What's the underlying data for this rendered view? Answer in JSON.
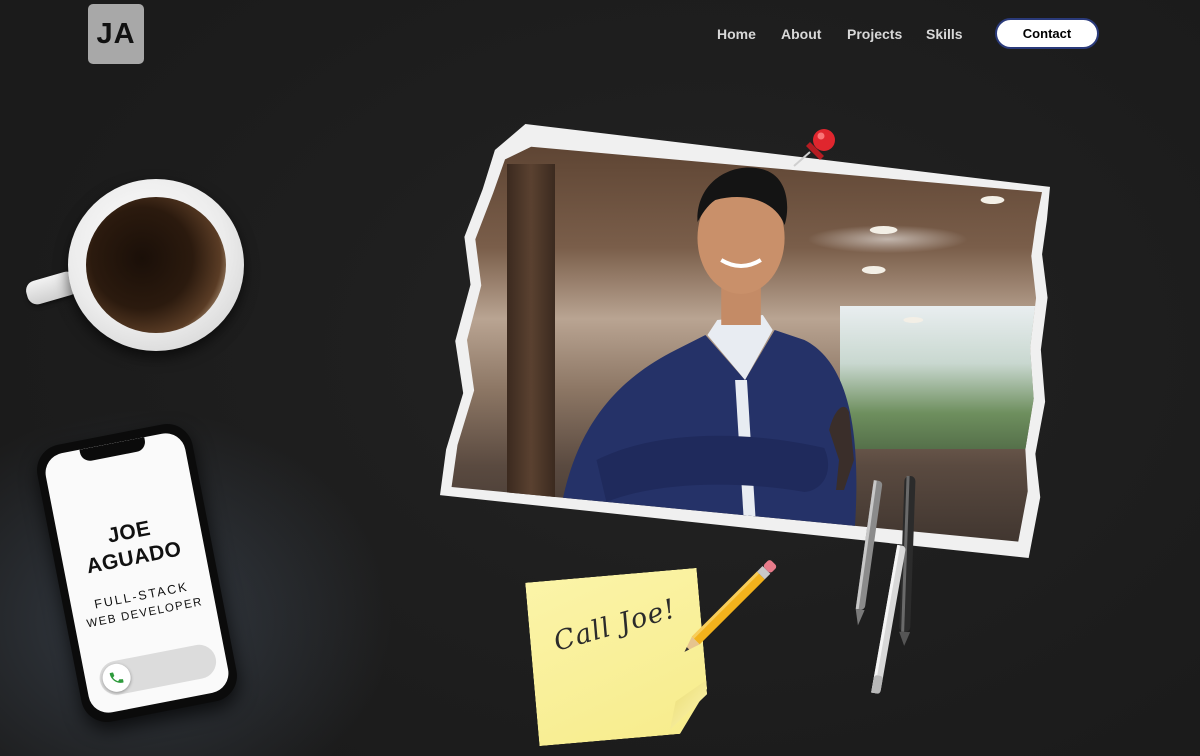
{
  "header": {
    "logo_text": "JA",
    "nav": [
      {
        "label": "Home"
      },
      {
        "label": "About"
      },
      {
        "label": "Projects"
      },
      {
        "label": "Skills"
      }
    ],
    "contact_label": "Contact"
  },
  "phone": {
    "name_line1": "JOE",
    "name_line2": "AGUADO",
    "role_line1": "FULL-STACK",
    "role_line2": "WEB DEVELOPER",
    "call_icon": "phone-icon"
  },
  "sticky_note": {
    "text": "Call Joe!"
  },
  "colors": {
    "background": "#1e1e1e",
    "logo_bg": "#a8a8a8",
    "contact_border": "#2a3a7a",
    "sticky": "#f7ec8c",
    "pin": "#d9232b",
    "call_green": "#2e9b3c"
  },
  "icons": [
    "coffee-cup-icon",
    "push-pin-icon",
    "pencil-icon",
    "pen-icon",
    "phone-icon"
  ]
}
